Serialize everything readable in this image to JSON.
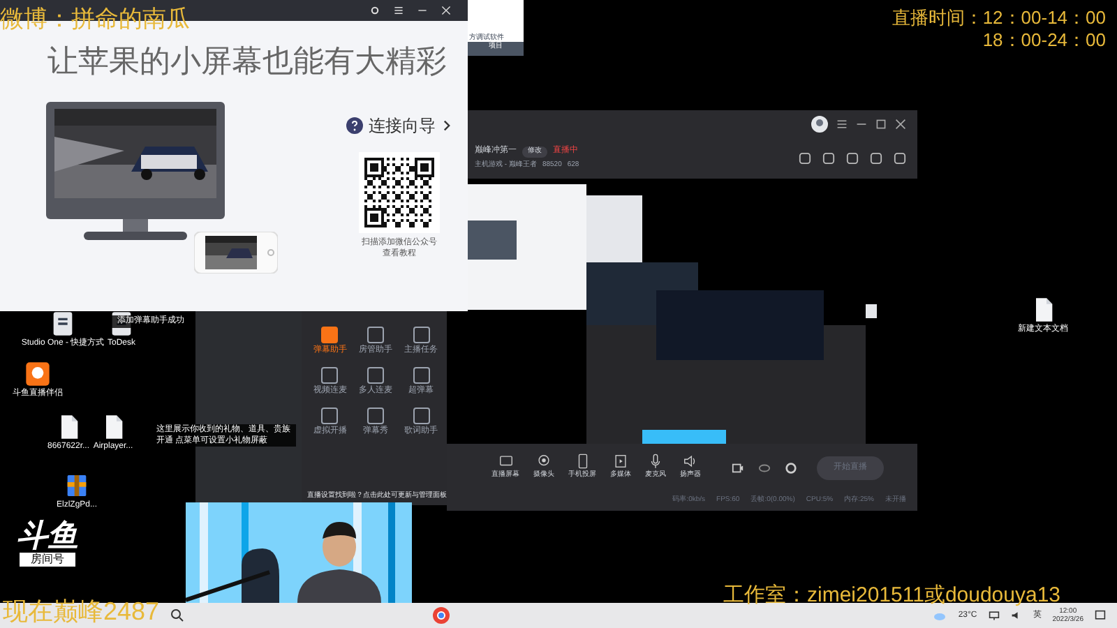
{
  "overlays": {
    "weibo": "微博：拼命的南瓜",
    "schedule": [
      "直播时间：12：00-14：00",
      "18：00-24：00"
    ],
    "studio": "工作室：zimei201511或doudouya13",
    "peak": "现在巅峰2487"
  },
  "projection_window": {
    "headline": "让苹果的小屏幕也能有大精彩",
    "guide_link": "连接向导",
    "qr_caption": [
      "扫描添加微信公众号",
      "查看教程"
    ]
  },
  "back_window": {
    "title": "方调试软件",
    "tab": "项目"
  },
  "stream_window": {
    "room_title": "巅峰冲第一",
    "edit_button": "修改",
    "live_badge": "直播中",
    "category": "主机游戏 - 巅峰王者",
    "followers": "88520",
    "hot": "628",
    "tools": [
      {
        "label": "直播屏幕",
        "kind": "screen"
      },
      {
        "label": "摄像头",
        "kind": "camera"
      },
      {
        "label": "手机投屏",
        "kind": "phone"
      },
      {
        "label": "多媒体",
        "kind": "media"
      },
      {
        "label": "麦克风",
        "kind": "mic"
      },
      {
        "label": "扬声器",
        "kind": "speaker"
      }
    ],
    "start_button": "开始直播",
    "status": [
      "码率:0kb/s",
      "FPS:60",
      "丢帧:0(0.00%)",
      "CPU:5%",
      "内存:25%",
      "未开播"
    ]
  },
  "assistant_panel": {
    "items": [
      {
        "label": "弹幕助手",
        "active": true
      },
      {
        "label": "房管助手",
        "active": false
      },
      {
        "label": "主播任务",
        "active": false
      },
      {
        "label": "视频连麦",
        "active": false
      },
      {
        "label": "多人连麦",
        "active": false
      },
      {
        "label": "超弹幕",
        "active": false
      },
      {
        "label": "虚拟开播",
        "active": false
      },
      {
        "label": "弹幕秀",
        "active": false
      },
      {
        "label": "歌词助手",
        "active": false
      }
    ],
    "notice": "直播设置找到啦？点击此处可更新与管理面板"
  },
  "toasts": [
    "添加弹幕助手成功",
    "这里展示你收到的礼物、道具、贵族开通 点菜单可设置小礼物屏蔽"
  ],
  "desktop_icons": [
    {
      "label": "Studio One - 快捷方式",
      "kind": "app"
    },
    {
      "label": "ToDesk",
      "kind": "app"
    },
    {
      "label": "斗鱼直播伴侣",
      "kind": "douyu"
    },
    {
      "label": "8667622r...",
      "kind": "file"
    },
    {
      "label": "Airplayer...",
      "kind": "file"
    },
    {
      "label": "ElzlZgPd...",
      "kind": "archive"
    },
    {
      "label": "新建文本文档",
      "kind": "file"
    }
  ],
  "douyu": {
    "logo": "斗鱼",
    "room_label": "房间号"
  },
  "taskbar": {
    "weather": "23°C",
    "ime": "英",
    "time": "12:00",
    "date": "2022/3/26"
  }
}
